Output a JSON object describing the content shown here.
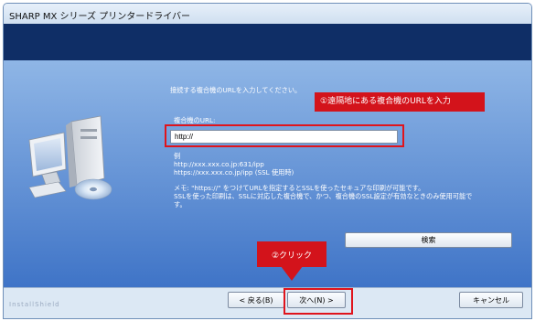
{
  "window": {
    "title": "SHARP MX シリーズ プリンタードライバー"
  },
  "main": {
    "instruction": "接続する複合機のURLを入力してください。",
    "url_label": "複合機のURL:",
    "url_value": "http://",
    "example_heading": "例",
    "example_line1": "http://xxx.xxx.co.jp:631/ipp",
    "example_line2": "https://xxx.xxx.co.jp/ipp (SSL 使用時)",
    "memo_line1": "メモ: \"https://\" をつけてURLを指定するとSSLを使ったセキュアな印刷が可能です。",
    "memo_line2": "SSLを使った印刷は、SSLに対応した複合機で、かつ、複合機のSSL設定が有効なときのみ使用可能で",
    "memo_line3": "す。",
    "search_button": "検索"
  },
  "annotations": {
    "callout_url": "①遠隔地にある複合機のURLを入力",
    "callout_click": "②クリック",
    "highlight_color": "#e0141c"
  },
  "footer": {
    "watermark": "InstallShield",
    "back_button": "< 戻る(B)",
    "next_button": "次へ(N) >",
    "cancel_button": "キャンセル"
  },
  "colors": {
    "header": "#0f2e66",
    "panel_top": "#8fb6e6",
    "panel_bottom": "#3f74c7",
    "callout": "#d3131b"
  }
}
